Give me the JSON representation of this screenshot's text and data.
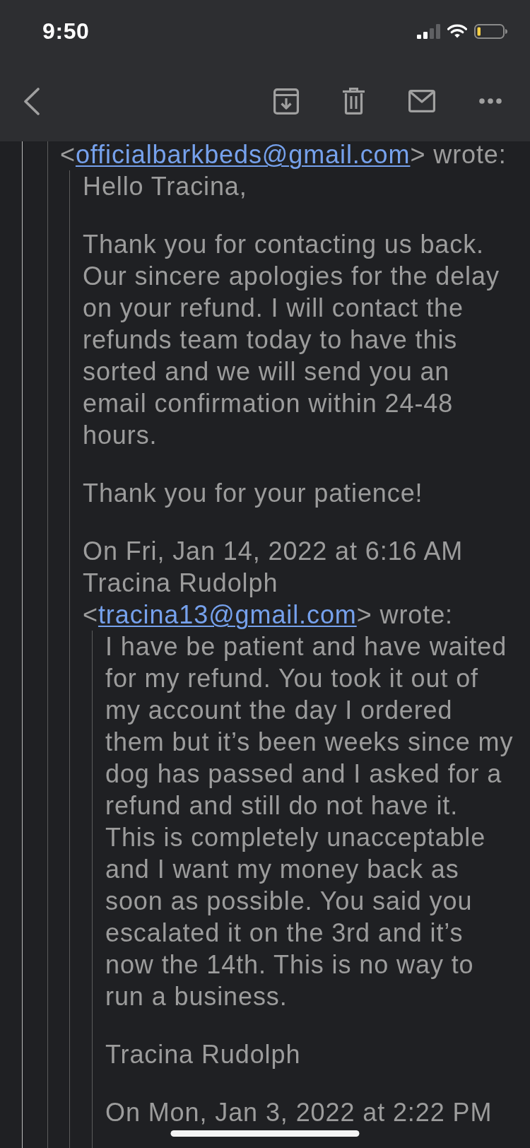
{
  "status_bar": {
    "time": "9:50"
  },
  "thread": {
    "quote": {
      "attribution": {
        "text_before": "<",
        "link": "officialbarkbeds@gmail.com",
        "text_after": "> wrote:"
      },
      "quote": {
        "paragraphs": [
          "Hello Tracina,",
          "Thank you for contacting us back. Our sincere apologies for the delay on your refund. I will contact the refunds team today to have this sorted and we will send you an email confirmation within 24-48 hours.",
          "Thank you for your patience!"
        ],
        "attribution": {
          "text_before": "On Fri, Jan 14, 2022 at 6:16 AM Tracina Rudolph <",
          "link": "tracina13@gmail.com",
          "text_after": "> wrote:"
        },
        "quote": {
          "paragraphs": [
            "I have be patient and have waited for my refund. You took it out of my account the day I ordered them but it’s been weeks since my dog has passed and I asked for a refund and still do not have it. This is completely unacceptable and I want my money back as soon as possible. You said you escalated it on the 3rd and it’s now the 14th. This is no way to run a business.",
            "Tracina Rudolph"
          ],
          "attribution": {
            "text_before": "On Mon, Jan 3, 2022 at 2:22 PM"
          }
        }
      }
    }
  }
}
